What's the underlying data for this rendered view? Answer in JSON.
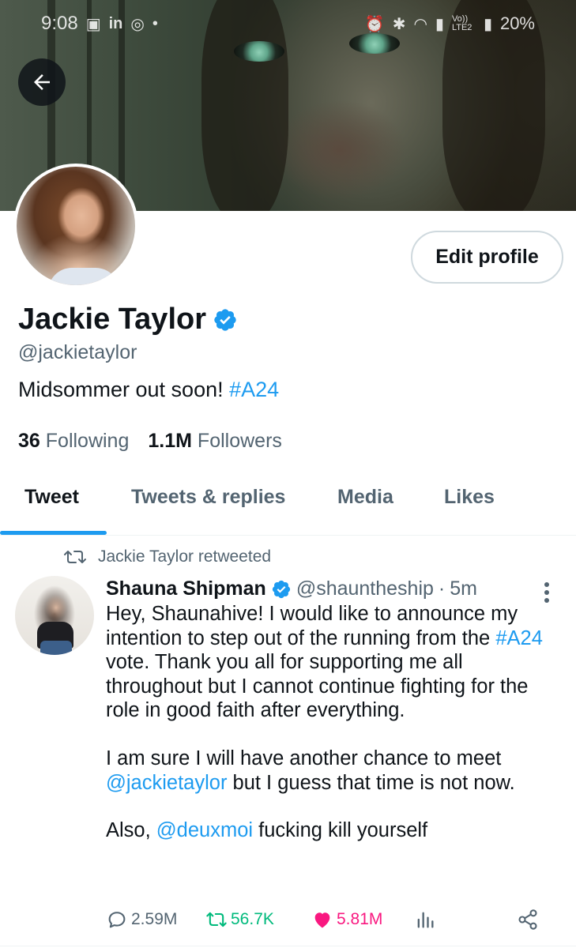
{
  "status_bar": {
    "time": "9:08",
    "left_icons": [
      "image-icon",
      "linkedin-icon",
      "instagram-icon",
      "dot-icon"
    ],
    "right_icons": [
      "alarm-icon",
      "vibrate-icon",
      "bluetooth-icon",
      "wifi-icon",
      "signal-icon",
      "volte-icon",
      "signal-icon"
    ],
    "volte_text": "Vo)) LTE2",
    "battery": "20%"
  },
  "profile": {
    "name": "Jackie Taylor",
    "handle": "@jackietaylor",
    "bio_text": "Midsommer out soon! ",
    "bio_hashtag": "#A24",
    "edit_button": "Edit profile",
    "following_count": "36",
    "following_label": "Following",
    "followers_count": "1.1M",
    "followers_label": "Followers"
  },
  "tabs": [
    {
      "label": "Tweet",
      "active": true
    },
    {
      "label": "Tweets & replies",
      "active": false
    },
    {
      "label": "Media",
      "active": false
    },
    {
      "label": "Likes",
      "active": false
    }
  ],
  "tweet": {
    "retweeted_by": "Jackie Taylor retweeted",
    "author_name": "Shauna Shipman",
    "author_handle": "@shauntheship",
    "separator": "·",
    "time": "5m",
    "line1": "Hey, Shaunahive! I would like to announce my intention to step out of the running from the ",
    "hashtag": "#A24",
    "line1_rest": " vote. Thank you all for supporting me all throughout but I cannot continue fighting for the role in good faith after everything.",
    "para2_start": "I am sure I will have another chance to meet ",
    "para2_mention": "@jackietaylor",
    "para2_end": " but I guess that time is not now.",
    "para3_start": "Also, ",
    "para3_mention": "@deuxmoi",
    "para3_end": " fucking kill yourself",
    "replies": "2.59M",
    "retweets": "56.7K",
    "likes": "5.81M"
  },
  "colors": {
    "accent": "#1d9bf0",
    "retweet": "#00ba7c",
    "like": "#f91880",
    "secondary_text": "#536471"
  }
}
